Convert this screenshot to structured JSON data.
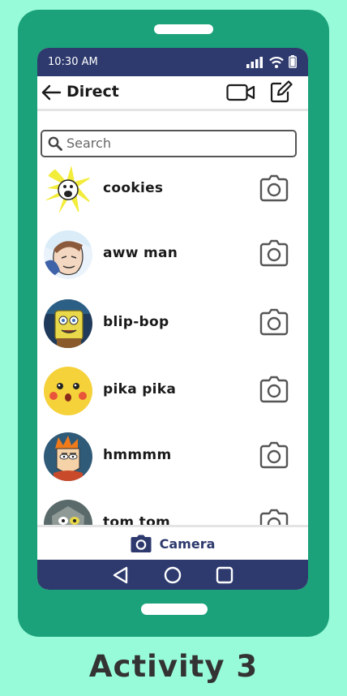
{
  "status_bar": {
    "time": "10:30 AM"
  },
  "app_bar": {
    "title": "Direct"
  },
  "search": {
    "placeholder": "Search"
  },
  "conversations": [
    {
      "name": "cookies"
    },
    {
      "name": "aww man"
    },
    {
      "name": "blip-bop"
    },
    {
      "name": "pika pika"
    },
    {
      "name": "hmmmm"
    },
    {
      "name": "tom tom"
    }
  ],
  "bottom_bar": {
    "camera_label": "Camera"
  },
  "caption": "Activity 3",
  "colors": {
    "background": "#97fbd9",
    "phone_body": "#1ba27a",
    "status_bar": "#2e3a6e",
    "accent": "#2e3a6e"
  },
  "icons": [
    "back-arrow-icon",
    "video-camera-icon",
    "compose-icon",
    "search-icon",
    "camera-icon",
    "nav-back-icon",
    "nav-home-icon",
    "nav-recents-icon",
    "signal-icon",
    "wifi-icon",
    "battery-icon"
  ]
}
